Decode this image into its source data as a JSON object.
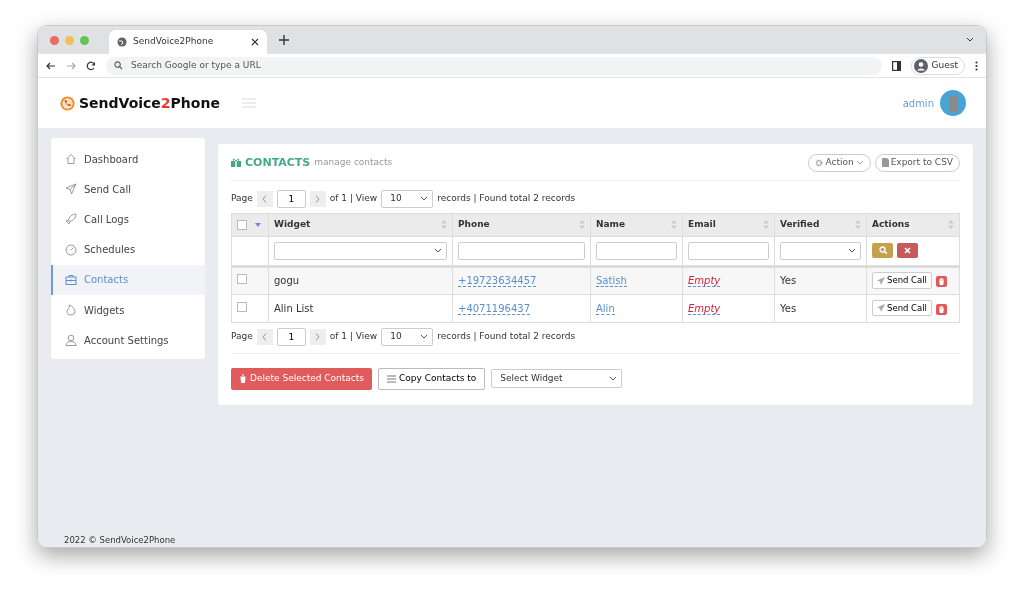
{
  "browser": {
    "tab_title": "SendVoice2Phone",
    "address_placeholder": "Search Google or type a URL",
    "profile": "Guest"
  },
  "header": {
    "logo": {
      "before": "SendVoice",
      "highlight": "2",
      "after": "Phone"
    },
    "user": "admin"
  },
  "sidebar": {
    "items": [
      {
        "label": "Dashboard",
        "selected": false
      },
      {
        "label": "Send Call",
        "selected": false
      },
      {
        "label": "Call Logs",
        "selected": false
      },
      {
        "label": "Schedules",
        "selected": false
      },
      {
        "label": "Contacts",
        "selected": true
      },
      {
        "label": "Widgets",
        "selected": false
      },
      {
        "label": "Account Settings",
        "selected": false
      }
    ]
  },
  "panel": {
    "title": "CONTACTS",
    "subtitle": "manage contacts",
    "buttons": [
      {
        "kind": "dropdown",
        "label": "Action"
      },
      {
        "kind": "export",
        "label": "Export to CSV"
      }
    ]
  },
  "pagers": [
    {
      "page_label": "Page",
      "page": "1",
      "of": "of 1 | View",
      "view": "10",
      "summary": "records | Found total 2 records"
    },
    {
      "page_label": "Page",
      "page": "1",
      "of": "of 1 | View",
      "view": "10",
      "summary": "records | Found total 2 records"
    }
  ],
  "table": {
    "select_all_checked": false,
    "columns": [
      {
        "label": "Widget",
        "kind": "select"
      },
      {
        "label": "Phone",
        "kind": "text"
      },
      {
        "label": "Name",
        "kind": "text"
      },
      {
        "label": "Email",
        "kind": "text"
      },
      {
        "label": "Verified",
        "kind": "select"
      },
      {
        "label": "Actions",
        "kind": "buttons"
      }
    ],
    "rows": [
      {
        "checked": false,
        "widget": "gogu",
        "phone": "+19723634457",
        "name": "Satish",
        "email": "Empty",
        "email_empty": true,
        "verified": "Yes",
        "action": "Send Call"
      },
      {
        "checked": false,
        "widget": "Alin List",
        "phone": "+4071196437",
        "name": "Alin",
        "email": "Empty",
        "email_empty": true,
        "verified": "Yes",
        "action": "Send Call"
      }
    ]
  },
  "bulk": {
    "delete": "Delete Selected Contacts",
    "copy": "Copy Contacts to",
    "select": "Select Widget"
  },
  "footer": "2022 © SendVoice2Phone"
}
